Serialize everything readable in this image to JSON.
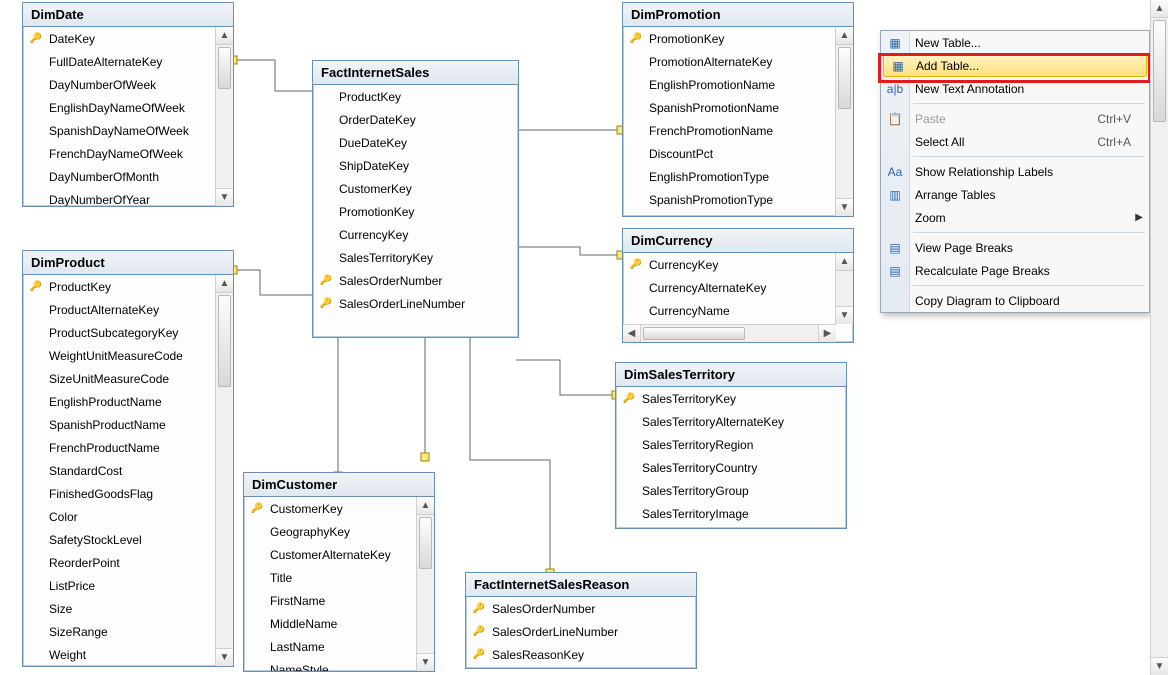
{
  "tables": {
    "dimDate": {
      "title": "DimDate",
      "columns": [
        {
          "name": "DateKey",
          "pk": true
        },
        {
          "name": "FullDateAlternateKey"
        },
        {
          "name": "DayNumberOfWeek"
        },
        {
          "name": "EnglishDayNameOfWeek"
        },
        {
          "name": "SpanishDayNameOfWeek"
        },
        {
          "name": "FrenchDayNameOfWeek"
        },
        {
          "name": "DayNumberOfMonth"
        },
        {
          "name": "DayNumberOfYear"
        }
      ]
    },
    "dimProduct": {
      "title": "DimProduct",
      "columns": [
        {
          "name": "ProductKey",
          "pk": true
        },
        {
          "name": "ProductAlternateKey"
        },
        {
          "name": "ProductSubcategoryKey"
        },
        {
          "name": "WeightUnitMeasureCode"
        },
        {
          "name": "SizeUnitMeasureCode"
        },
        {
          "name": "EnglishProductName"
        },
        {
          "name": "SpanishProductName"
        },
        {
          "name": "FrenchProductName"
        },
        {
          "name": "StandardCost"
        },
        {
          "name": "FinishedGoodsFlag"
        },
        {
          "name": "Color"
        },
        {
          "name": "SafetyStockLevel"
        },
        {
          "name": "ReorderPoint"
        },
        {
          "name": "ListPrice"
        },
        {
          "name": "Size"
        },
        {
          "name": "SizeRange"
        },
        {
          "name": "Weight"
        }
      ]
    },
    "factInternetSales": {
      "title": "FactInternetSales",
      "columns": [
        {
          "name": "ProductKey"
        },
        {
          "name": "OrderDateKey"
        },
        {
          "name": "DueDateKey"
        },
        {
          "name": "ShipDateKey"
        },
        {
          "name": "CustomerKey"
        },
        {
          "name": "PromotionKey"
        },
        {
          "name": "CurrencyKey"
        },
        {
          "name": "SalesTerritoryKey"
        },
        {
          "name": "SalesOrderNumber",
          "pk": true
        },
        {
          "name": "SalesOrderLineNumber",
          "pk": true
        }
      ]
    },
    "dimPromotion": {
      "title": "DimPromotion",
      "columns": [
        {
          "name": "PromotionKey",
          "pk": true
        },
        {
          "name": "PromotionAlternateKey"
        },
        {
          "name": "EnglishPromotionName"
        },
        {
          "name": "SpanishPromotionName"
        },
        {
          "name": "FrenchPromotionName"
        },
        {
          "name": "DiscountPct"
        },
        {
          "name": "EnglishPromotionType"
        },
        {
          "name": "SpanishPromotionType"
        }
      ]
    },
    "dimCurrency": {
      "title": "DimCurrency",
      "columns": [
        {
          "name": "CurrencyKey",
          "pk": true
        },
        {
          "name": "CurrencyAlternateKey"
        },
        {
          "name": "CurrencyName"
        }
      ]
    },
    "dimSalesTerritory": {
      "title": "DimSalesTerritory",
      "columns": [
        {
          "name": "SalesTerritoryKey",
          "pk": true
        },
        {
          "name": "SalesTerritoryAlternateKey"
        },
        {
          "name": "SalesTerritoryRegion"
        },
        {
          "name": "SalesTerritoryCountry"
        },
        {
          "name": "SalesTerritoryGroup"
        },
        {
          "name": "SalesTerritoryImage"
        }
      ]
    },
    "dimCustomer": {
      "title": "DimCustomer",
      "columns": [
        {
          "name": "CustomerKey",
          "pk": true
        },
        {
          "name": "GeographyKey"
        },
        {
          "name": "CustomerAlternateKey"
        },
        {
          "name": "Title"
        },
        {
          "name": "FirstName"
        },
        {
          "name": "MiddleName"
        },
        {
          "name": "LastName"
        },
        {
          "name": "NameStyle"
        }
      ]
    },
    "factInternetSalesReason": {
      "title": "FactInternetSalesReason",
      "columns": [
        {
          "name": "SalesOrderNumber",
          "pk": true
        },
        {
          "name": "SalesOrderLineNumber",
          "pk": true
        },
        {
          "name": "SalesReasonKey",
          "pk": true
        }
      ]
    }
  },
  "menu": {
    "items": [
      {
        "label": "New Table...",
        "icon": "▦",
        "iconColor": "blue"
      },
      {
        "label": "Add Table...",
        "icon": "▦",
        "iconColor": "blue",
        "hover": true
      },
      {
        "label": "New Text Annotation",
        "icon": "a|b",
        "iconColor": "blue"
      },
      {
        "sep": true
      },
      {
        "label": "Paste",
        "icon": "📋",
        "iconColor": "gray",
        "shortcut": "Ctrl+V",
        "disabled": true
      },
      {
        "label": "Select All",
        "shortcut": "Ctrl+A"
      },
      {
        "sep": true
      },
      {
        "label": "Show Relationship Labels",
        "icon": "Aa",
        "iconColor": "blue"
      },
      {
        "label": "Arrange Tables",
        "icon": "▥",
        "iconColor": "blue"
      },
      {
        "label": "Zoom",
        "submenu": true
      },
      {
        "sep": true
      },
      {
        "label": "View Page Breaks",
        "icon": "▤",
        "iconColor": "blue"
      },
      {
        "label": "Recalculate Page Breaks",
        "icon": "▤",
        "iconColor": "blue"
      },
      {
        "sep": true
      },
      {
        "label": "Copy Diagram to Clipboard"
      }
    ]
  }
}
